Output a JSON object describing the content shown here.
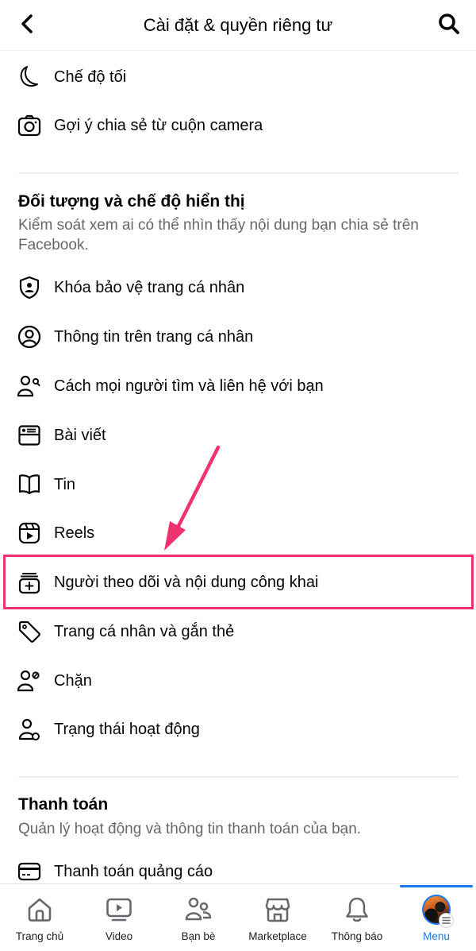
{
  "header": {
    "title": "Cài đặt & quyền riêng tư",
    "back_icon": "chevron-left-icon",
    "search_icon": "search-icon"
  },
  "preferences": {
    "items": [
      {
        "label": "Chế độ tối",
        "icon": "moon-icon"
      },
      {
        "label": "Gợi ý chia sẻ từ cuộn camera",
        "icon": "camera-icon"
      }
    ]
  },
  "audience_section": {
    "title": "Đối tượng và chế độ hiển thị",
    "description": "Kiểm soát xem ai có thể nhìn thấy nội dung bạn chia sẻ trên Facebook.",
    "items": [
      {
        "label": "Khóa bảo vệ trang cá nhân",
        "icon": "shield-user-icon"
      },
      {
        "label": "Thông tin trên trang cá nhân",
        "icon": "user-circle-icon"
      },
      {
        "label": "Cách mọi người tìm và liên hệ với bạn",
        "icon": "user-search-icon"
      },
      {
        "label": "Bài viết",
        "icon": "post-icon"
      },
      {
        "label": "Tin",
        "icon": "book-icon"
      },
      {
        "label": "Reels",
        "icon": "reels-icon"
      },
      {
        "label": "Người theo dõi và nội dung công khai",
        "icon": "followers-icon",
        "highlighted": true
      },
      {
        "label": "Trang cá nhân và gắn thẻ",
        "icon": "tag-icon"
      },
      {
        "label": "Chặn",
        "icon": "user-block-icon"
      },
      {
        "label": "Trạng thái hoạt động",
        "icon": "user-status-icon"
      }
    ]
  },
  "payments_section": {
    "title": "Thanh toán",
    "description": "Quản lý hoạt động và thông tin thanh toán của bạn.",
    "items": [
      {
        "label": "Thanh toán quảng cáo",
        "icon": "credit-card-icon"
      }
    ]
  },
  "annotation": {
    "color": "#f0336e"
  },
  "tabbar": {
    "active_color": "#1877f2",
    "tabs": [
      {
        "label": "Trang chủ",
        "icon": "home-icon"
      },
      {
        "label": "Video",
        "icon": "video-icon"
      },
      {
        "label": "Bạn bè",
        "icon": "friends-icon"
      },
      {
        "label": "Marketplace",
        "icon": "marketplace-icon"
      },
      {
        "label": "Thông báo",
        "icon": "bell-icon"
      },
      {
        "label": "Menu",
        "icon": "avatar-menu-icon",
        "active": true
      }
    ]
  }
}
